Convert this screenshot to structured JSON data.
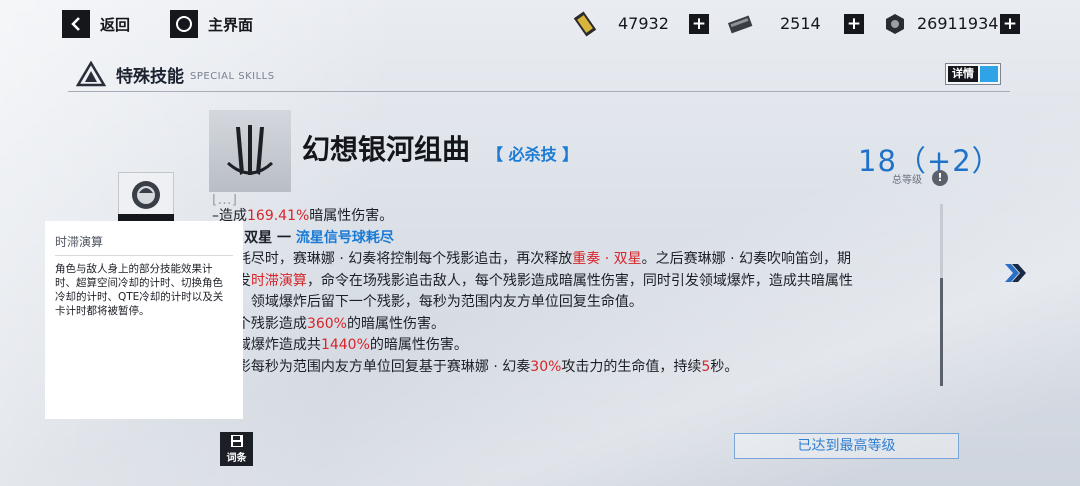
{
  "topbar": {
    "back_label": "返回",
    "home_label": "主界面",
    "resources": [
      {
        "icon": "gold-card-icon",
        "value": "47932"
      },
      {
        "icon": "ticket-icon",
        "value": "2514"
      },
      {
        "icon": "hex-coin-icon",
        "value": "26911934"
      }
    ]
  },
  "section": {
    "title": "特殊技能",
    "subtitle": "SPECIAL SKILLS",
    "detail_label": "详情"
  },
  "skill": {
    "name": "幻想银河组曲",
    "tag": "【 必杀技 】",
    "level": "18（+2）",
    "level_label": "总等级"
  },
  "description": {
    "line0": "[…]",
    "line1_a": "–造成",
    "line1_b": "169.41%",
    "line1_c": "暗属性伤害。",
    "line2_a": "[…]·双星 一 ",
    "line2_b": "流星信号球耗尽",
    "line3_a": "[…]耗尽时，赛琳娜 · 幻奏将控制每个残影追击，再次释放",
    "line3_b": "重奏 · 双星",
    "line3_c": "。之后赛琳娜 · 幻奏吹响笛剑，期",
    "line4_a": "[…]发",
    "line4_b": "时滞演算",
    "line4_c": "，命令在场残影追击敌人，每个残影造成暗属性伤害，同时引发领域爆炸，造成共暗属性",
    "line5": "[…]，领域爆炸后留下一个残影，每秒为范围内友方单位回复生命值。",
    "line6_a": "[…]个残影造成",
    "line6_b": "360%",
    "line6_c": "的暗属性伤害。",
    "line7_a": "[…]域爆炸造成共",
    "line7_b": "1440%",
    "line7_c": "的暗属性伤害。",
    "line8_a": "[…]影每秒为范围内友方单位回复基于赛琳娜 · 幻奏",
    "line8_b": "30%",
    "line8_c": "攻击力的生命值，持续",
    "line8_d": "5",
    "line8_e": "秒。"
  },
  "tooltip": {
    "title": "时滞演算",
    "body": "角色与敌人身上的部分技能效果计时、超算空间冷却的计时、切换角色冷却的计时、QTE冷却的计时以及关卡计时都将被暂停。"
  },
  "term_button_label": "词条",
  "max_level_label": "已达到最高等级",
  "colors": {
    "accent_blue": "#1f72c8",
    "highlight_red": "#d8242a",
    "toggle_blue": "#2fa3e6"
  }
}
